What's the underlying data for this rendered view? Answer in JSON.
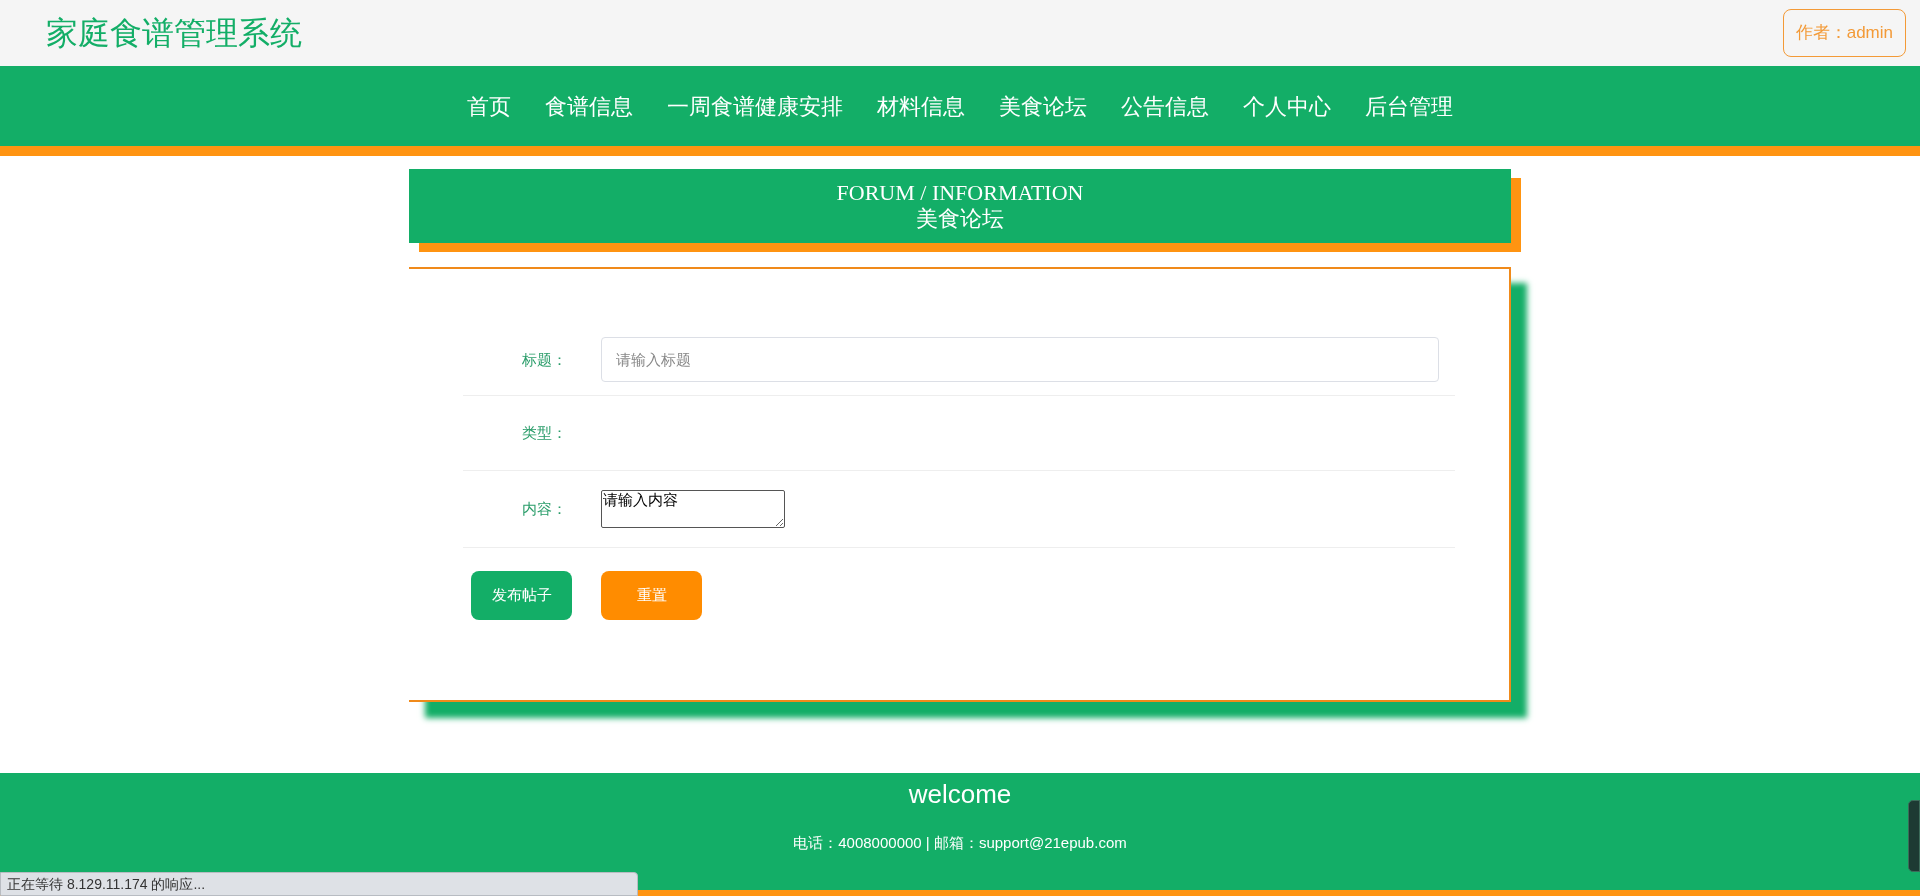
{
  "header": {
    "title": "家庭食谱管理系统",
    "author_badge": "作者：admin"
  },
  "nav": {
    "items": [
      "首页",
      "食谱信息",
      "一周食谱健康安排",
      "材料信息",
      "美食论坛",
      "公告信息",
      "个人中心",
      "后台管理"
    ]
  },
  "section_banner": {
    "english": "FORUM / INFORMATION",
    "title": "美食论坛"
  },
  "form": {
    "fields": [
      {
        "kind": "input",
        "label": "标题：",
        "placeholder": "请输入标题"
      },
      {
        "kind": "empty",
        "label": "类型："
      },
      {
        "kind": "textarea",
        "label": "内容：",
        "placeholder": "请输入内容"
      }
    ],
    "buttons": [
      {
        "kind": "primary",
        "label": "发布帖子"
      },
      {
        "kind": "reset",
        "label": "重置"
      }
    ]
  },
  "footer": {
    "heading": "welcome",
    "contact": "电话：4008000000 | 邮箱：support@21epub.com"
  },
  "status_bar": {
    "text": "正在等待 8.129.11.174 的响应..."
  }
}
